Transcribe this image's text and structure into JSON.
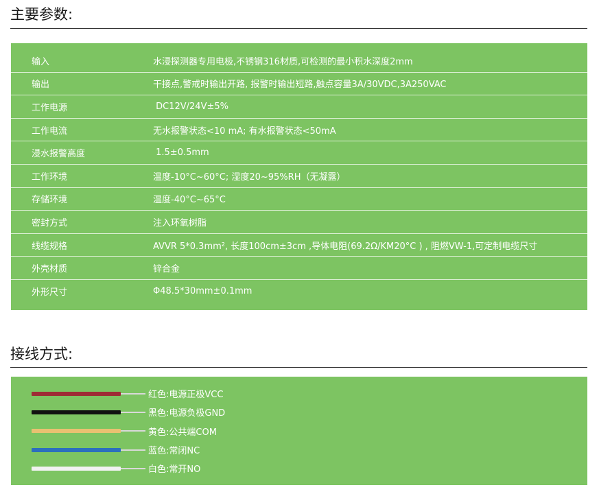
{
  "specs": {
    "title": "主要参数:",
    "rows": [
      {
        "label": "输入",
        "value": "水浸探测器专用电极,不锈钢316材质,可检测的最小积水深度2mm"
      },
      {
        "label": "输出",
        "value": "干接点,警戒时输出开路, 报警时输出短路,触点容量3A/30VDC,3A250VAC"
      },
      {
        "label": "工作电源",
        "value": " DC12V/24V±5%"
      },
      {
        "label": "工作电流",
        "value": "无水报警状态<10 mA; 有水报警状态<50mA"
      },
      {
        "label": "浸水报警高度",
        "value": " 1.5±0.5mm"
      },
      {
        "label": "工作环境",
        "value": "温度-10°C~60°C; 湿度20~95%RH（无凝露）"
      },
      {
        "label": "存储环境",
        "value": "温度-40°C~65°C"
      },
      {
        "label": "密封方式",
        "value": "注入环氧树脂"
      },
      {
        "label": "线缆规格",
        "value": "AVVR 5*0.3mm², 长度100cm±3cm ,导体电阻(69.2Ω/KM20°C ) , 阻燃VW-1,可定制电缆尺寸"
      },
      {
        "label": "外壳材质",
        "value": "锌合金"
      },
      {
        "label": "外形尺寸",
        "value": "Φ48.5*30mm±0.1mm"
      }
    ]
  },
  "wiring": {
    "title": "接线方式:",
    "wires": [
      {
        "label": "红色:电源正极VCC",
        "color": "#9e2b35"
      },
      {
        "label": "黑色:电源负极GND",
        "color": "#111111"
      },
      {
        "label": "黄色:公共端COM",
        "color": "#e9c171"
      },
      {
        "label": "蓝色:常闭NC",
        "color": "#2c6fbe"
      },
      {
        "label": "白色:常开NO",
        "color": "#f2f2f2"
      }
    ]
  },
  "colors": {
    "panel": "#7dc462",
    "text": "#ffffff",
    "title": "#1a1a1a"
  }
}
